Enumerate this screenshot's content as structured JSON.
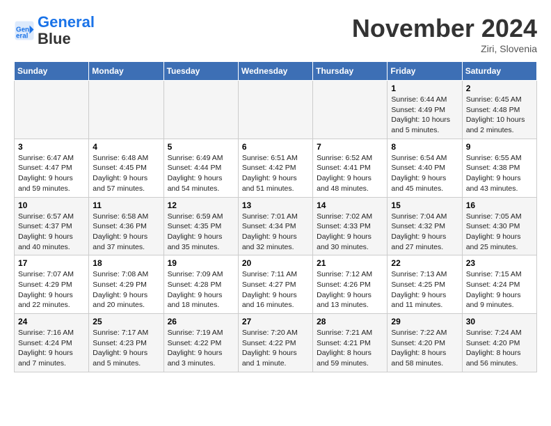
{
  "header": {
    "logo_line1": "General",
    "logo_line2": "Blue",
    "month_title": "November 2024",
    "location": "Ziri, Slovenia"
  },
  "weekdays": [
    "Sunday",
    "Monday",
    "Tuesday",
    "Wednesday",
    "Thursday",
    "Friday",
    "Saturday"
  ],
  "weeks": [
    [
      {
        "day": "",
        "info": ""
      },
      {
        "day": "",
        "info": ""
      },
      {
        "day": "",
        "info": ""
      },
      {
        "day": "",
        "info": ""
      },
      {
        "day": "",
        "info": ""
      },
      {
        "day": "1",
        "info": "Sunrise: 6:44 AM\nSunset: 4:49 PM\nDaylight: 10 hours\nand 5 minutes."
      },
      {
        "day": "2",
        "info": "Sunrise: 6:45 AM\nSunset: 4:48 PM\nDaylight: 10 hours\nand 2 minutes."
      }
    ],
    [
      {
        "day": "3",
        "info": "Sunrise: 6:47 AM\nSunset: 4:47 PM\nDaylight: 9 hours\nand 59 minutes."
      },
      {
        "day": "4",
        "info": "Sunrise: 6:48 AM\nSunset: 4:45 PM\nDaylight: 9 hours\nand 57 minutes."
      },
      {
        "day": "5",
        "info": "Sunrise: 6:49 AM\nSunset: 4:44 PM\nDaylight: 9 hours\nand 54 minutes."
      },
      {
        "day": "6",
        "info": "Sunrise: 6:51 AM\nSunset: 4:42 PM\nDaylight: 9 hours\nand 51 minutes."
      },
      {
        "day": "7",
        "info": "Sunrise: 6:52 AM\nSunset: 4:41 PM\nDaylight: 9 hours\nand 48 minutes."
      },
      {
        "day": "8",
        "info": "Sunrise: 6:54 AM\nSunset: 4:40 PM\nDaylight: 9 hours\nand 45 minutes."
      },
      {
        "day": "9",
        "info": "Sunrise: 6:55 AM\nSunset: 4:38 PM\nDaylight: 9 hours\nand 43 minutes."
      }
    ],
    [
      {
        "day": "10",
        "info": "Sunrise: 6:57 AM\nSunset: 4:37 PM\nDaylight: 9 hours\nand 40 minutes."
      },
      {
        "day": "11",
        "info": "Sunrise: 6:58 AM\nSunset: 4:36 PM\nDaylight: 9 hours\nand 37 minutes."
      },
      {
        "day": "12",
        "info": "Sunrise: 6:59 AM\nSunset: 4:35 PM\nDaylight: 9 hours\nand 35 minutes."
      },
      {
        "day": "13",
        "info": "Sunrise: 7:01 AM\nSunset: 4:34 PM\nDaylight: 9 hours\nand 32 minutes."
      },
      {
        "day": "14",
        "info": "Sunrise: 7:02 AM\nSunset: 4:33 PM\nDaylight: 9 hours\nand 30 minutes."
      },
      {
        "day": "15",
        "info": "Sunrise: 7:04 AM\nSunset: 4:32 PM\nDaylight: 9 hours\nand 27 minutes."
      },
      {
        "day": "16",
        "info": "Sunrise: 7:05 AM\nSunset: 4:30 PM\nDaylight: 9 hours\nand 25 minutes."
      }
    ],
    [
      {
        "day": "17",
        "info": "Sunrise: 7:07 AM\nSunset: 4:29 PM\nDaylight: 9 hours\nand 22 minutes."
      },
      {
        "day": "18",
        "info": "Sunrise: 7:08 AM\nSunset: 4:29 PM\nDaylight: 9 hours\nand 20 minutes."
      },
      {
        "day": "19",
        "info": "Sunrise: 7:09 AM\nSunset: 4:28 PM\nDaylight: 9 hours\nand 18 minutes."
      },
      {
        "day": "20",
        "info": "Sunrise: 7:11 AM\nSunset: 4:27 PM\nDaylight: 9 hours\nand 16 minutes."
      },
      {
        "day": "21",
        "info": "Sunrise: 7:12 AM\nSunset: 4:26 PM\nDaylight: 9 hours\nand 13 minutes."
      },
      {
        "day": "22",
        "info": "Sunrise: 7:13 AM\nSunset: 4:25 PM\nDaylight: 9 hours\nand 11 minutes."
      },
      {
        "day": "23",
        "info": "Sunrise: 7:15 AM\nSunset: 4:24 PM\nDaylight: 9 hours\nand 9 minutes."
      }
    ],
    [
      {
        "day": "24",
        "info": "Sunrise: 7:16 AM\nSunset: 4:24 PM\nDaylight: 9 hours\nand 7 minutes."
      },
      {
        "day": "25",
        "info": "Sunrise: 7:17 AM\nSunset: 4:23 PM\nDaylight: 9 hours\nand 5 minutes."
      },
      {
        "day": "26",
        "info": "Sunrise: 7:19 AM\nSunset: 4:22 PM\nDaylight: 9 hours\nand 3 minutes."
      },
      {
        "day": "27",
        "info": "Sunrise: 7:20 AM\nSunset: 4:22 PM\nDaylight: 9 hours\nand 1 minute."
      },
      {
        "day": "28",
        "info": "Sunrise: 7:21 AM\nSunset: 4:21 PM\nDaylight: 8 hours\nand 59 minutes."
      },
      {
        "day": "29",
        "info": "Sunrise: 7:22 AM\nSunset: 4:20 PM\nDaylight: 8 hours\nand 58 minutes."
      },
      {
        "day": "30",
        "info": "Sunrise: 7:24 AM\nSunset: 4:20 PM\nDaylight: 8 hours\nand 56 minutes."
      }
    ]
  ]
}
